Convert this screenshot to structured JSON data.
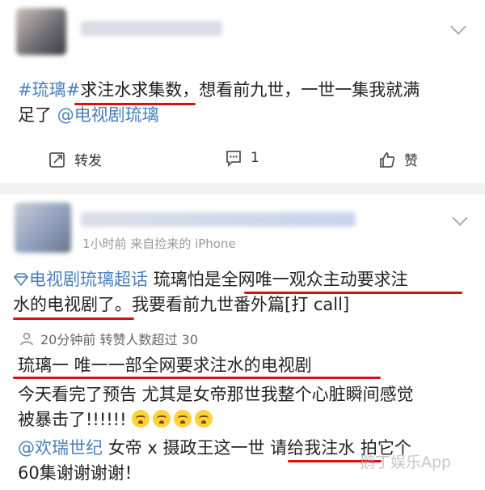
{
  "post1": {
    "text_line1_parts": [
      "#琉璃#",
      "求注水求集数",
      "，想看前九世，一世一集我就满"
    ],
    "text_line2_parts": [
      "足了",
      "@电视剧琉璃"
    ],
    "actions": {
      "repost": "转发",
      "comments": "1",
      "like": "赞"
    }
  },
  "post2": {
    "meta": "1小时前  来自捡来的 iPhone",
    "line1_parts": [
      "电视剧琉璃超话",
      "琉璃怕是",
      "全网唯一观众主动要求注"
    ],
    "line2_parts": [
      "水的电视剧了",
      "。我要看前九世番外篇[打 call]"
    ]
  },
  "comment_meta": "20分钟前  转赞人数超过 30",
  "comment_text": "琉璃一 唯一一部全网要求注水的电视剧",
  "comment2_line1": "今天看完了预告 尤其是女帝那世我整个心脏瞬间感觉",
  "comment2_line2": "被暴击了!!!!!!",
  "comment3_line1_parts": [
    "@欢瑞世纪",
    "女帝 x 摄政王这一世",
    "请给我注水",
    "拍它个"
  ],
  "comment3_line2": "60集谢谢谢谢！",
  "watermark": "鹅丁娱乐App",
  "colors": {
    "link": "#4a7fbd",
    "highlight_underline": "#d81010",
    "separator": "#f2f2f2"
  }
}
